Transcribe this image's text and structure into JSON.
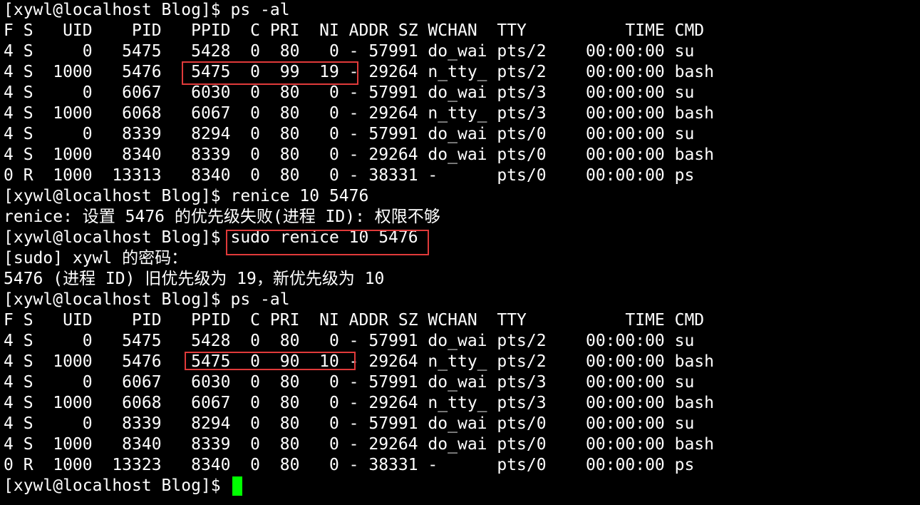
{
  "terminal": {
    "lines": [
      "[xywl@localhost Blog]$ ps -al",
      "F S   UID    PID   PPID  C PRI  NI ADDR SZ WCHAN  TTY          TIME CMD",
      "4 S     0   5475   5428  0  80   0 - 57991 do_wai pts/2    00:00:00 su",
      "4 S  1000   5476   5475  0  99  19 - 29264 n_tty_ pts/2    00:00:00 bash",
      "4 S     0   6067   6030  0  80   0 - 57991 do_wai pts/3    00:00:00 su",
      "4 S  1000   6068   6067  0  80   0 - 29264 n_tty_ pts/3    00:00:00 bash",
      "4 S     0   8339   8294  0  80   0 - 57991 do_wai pts/0    00:00:00 su",
      "4 S  1000   8340   8339  0  80   0 - 29264 do_wai pts/0    00:00:00 bash",
      "0 R  1000  13313   8340  0  80   0 - 38331 -      pts/0    00:00:00 ps",
      "[xywl@localhost Blog]$ renice 10 5476",
      "renice: 设置 5476 的优先级失败(进程 ID): 权限不够",
      "[xywl@localhost Blog]$ sudo renice 10 5476",
      "[sudo] xywl 的密码：",
      "5476 (进程 ID) 旧优先级为 19，新优先级为 10",
      "[xywl@localhost Blog]$ ps -al",
      "F S   UID    PID   PPID  C PRI  NI ADDR SZ WCHAN  TTY          TIME CMD",
      "4 S     0   5475   5428  0  80   0 - 57991 do_wai pts/2    00:00:00 su",
      "4 S  1000   5476   5475  0  90  10 - 29264 n_tty_ pts/2    00:00:00 bash",
      "4 S     0   6067   6030  0  80   0 - 57991 do_wai pts/3    00:00:00 su",
      "4 S  1000   6068   6067  0  80   0 - 29264 n_tty_ pts/3    00:00:00 bash",
      "4 S     0   8339   8294  0  80   0 - 57991 do_wai pts/0    00:00:00 su",
      "4 S  1000   8340   8339  0  80   0 - 29264 do_wai pts/0    00:00:00 bash",
      "0 R  1000  13323   8340  0  80   0 - 38331 -      pts/0    00:00:00 ps",
      "[xywl@localhost Blog]$ "
    ]
  },
  "colors": {
    "background": "#000000",
    "text": "#ffffff",
    "cursor": "#00ff00",
    "highlight_box": "#e03a3a"
  }
}
